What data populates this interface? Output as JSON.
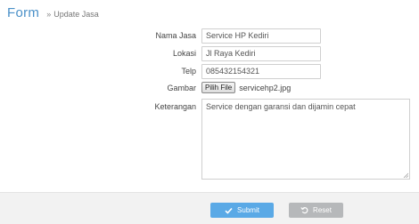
{
  "header": {
    "title": "Form",
    "breadcrumb_separator": "»",
    "breadcrumb": "Update Jasa"
  },
  "form": {
    "nama_jasa": {
      "label": "Nama Jasa",
      "value": "Service HP Kediri"
    },
    "lokasi": {
      "label": "Lokasi",
      "value": "Jl Raya Kediri"
    },
    "telp": {
      "label": "Telp",
      "value": "085432154321"
    },
    "gambar": {
      "label": "Gambar",
      "button_label": "Pilih File",
      "file_name": "servicehp2.jpg"
    },
    "keterangan": {
      "label": "Keterangan",
      "value": "Service dengan garansi dan dijamin cepat"
    }
  },
  "footer": {
    "submit_label": "Submit",
    "reset_label": "Reset"
  },
  "colors": {
    "accent": "#5aa9e6",
    "title": "#4a90c8",
    "reset": "#b6b8ba"
  }
}
